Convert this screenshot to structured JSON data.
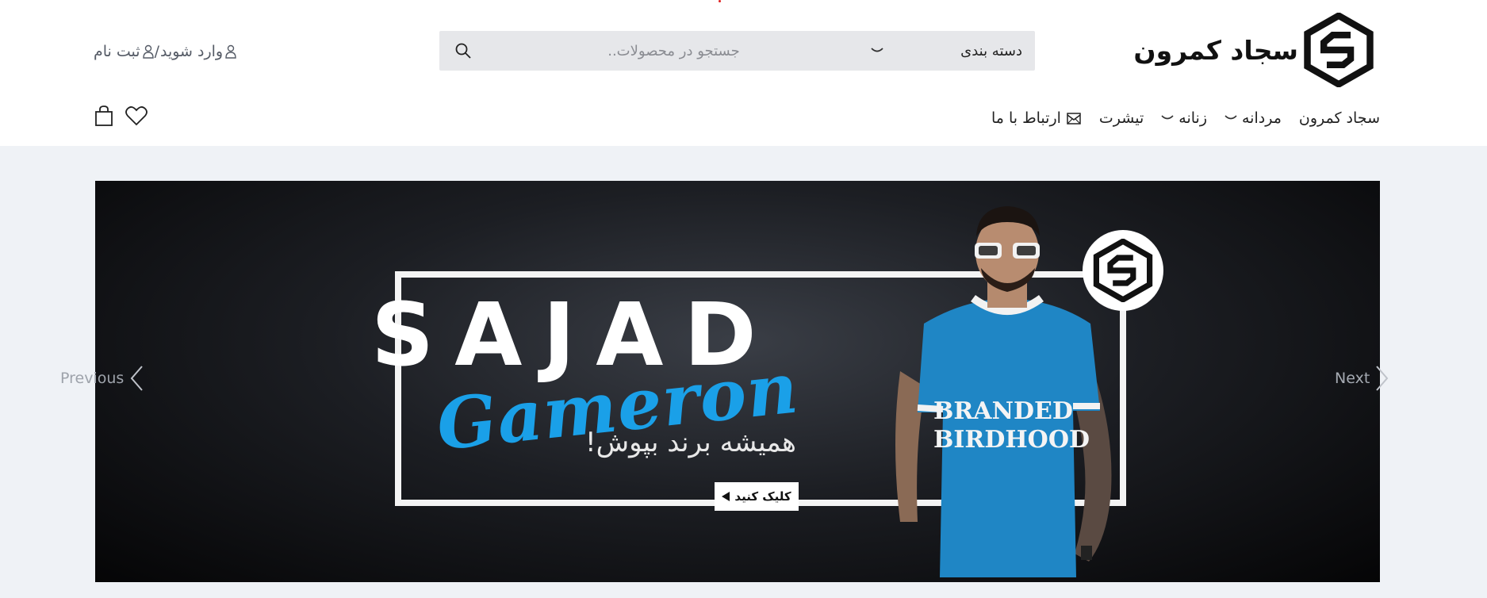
{
  "header": {
    "brand_name": "سجاد کمرون",
    "search": {
      "category_label": "دسته بندی",
      "placeholder": "جستجو در محصولات.."
    },
    "account": {
      "login_label": "وارد شوید",
      "separator": "/",
      "register_label": "ثبت نام"
    }
  },
  "nav": {
    "items": [
      {
        "label": "سجاد کمرون",
        "icon": "",
        "dropdown": false
      },
      {
        "label": "مردانه",
        "icon": "chevron-down-icon",
        "dropdown": true
      },
      {
        "label": "زنانه",
        "icon": "chevron-down-icon",
        "dropdown": true
      },
      {
        "label": "تیشرت",
        "icon": "",
        "dropdown": false
      },
      {
        "label": "ارتباط با ما",
        "icon": "mail-icon",
        "dropdown": false
      }
    ]
  },
  "header_icons": [
    "shopping-bag-icon",
    "heart-icon"
  ],
  "slider": {
    "prev_label": "Previous",
    "next_label": "Next",
    "banner": {
      "brand_primary": "SAJAD",
      "brand_script": "Gameron",
      "tagline": "همیشه برند بپوش!",
      "cta_label": "کلیک کنید",
      "shirt_text": [
        "BRANDED",
        "BIRDHOOD"
      ]
    }
  },
  "colors": {
    "accent_blue": "#1aa0e8",
    "search_bg": "#e6e7ea",
    "band_bg": "#eff2f6",
    "banner_dark": "#1c1e23"
  }
}
